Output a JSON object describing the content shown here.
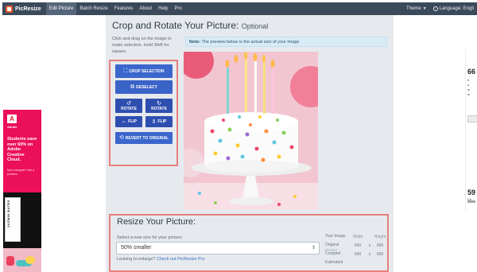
{
  "nav": {
    "brand": "PicResize",
    "items": [
      {
        "label": "Edit Picture",
        "active": true
      },
      {
        "label": "Batch Resize",
        "active": false
      },
      {
        "label": "Features",
        "active": false
      },
      {
        "label": "About",
        "active": false
      },
      {
        "label": "Help",
        "active": false
      },
      {
        "label": "Pro",
        "active": false
      }
    ],
    "theme_label": "Theme",
    "language_label": "Language: Engli"
  },
  "crop": {
    "title": "Crop and Rotate Your Picture:",
    "title_optional": "Optional",
    "hint": "Click and drag on the image to make selection. Hold Shift for square.",
    "note_bold": "Note:",
    "note_text": "The preview below is the actual size of your image",
    "buttons": {
      "crop": "CROP SELECTION",
      "deselect": "DESELECT",
      "rotate_left": "ROTATE",
      "rotate_right": "ROTATE",
      "flip_h": "FLIP",
      "flip_v": "FLIP",
      "revert": "REVERT TO ORIGINAL"
    }
  },
  "resize": {
    "title": "Resize Your Picture:",
    "select_label": "Select a new size for your picture:",
    "selected": "50% smaller",
    "enlarge_text": "Looking to enlarge?",
    "enlarge_link": "Check out PicResize Pro",
    "table": {
      "headers": [
        "Your Image",
        "Width",
        "Height"
      ],
      "rows": [
        {
          "label": "Original",
          "sub": "(Pixels)",
          "width": "600",
          "x": "x",
          "height": "600"
        },
        {
          "label": "Cropped",
          "sub": "",
          "width": "600",
          "x": "x",
          "height": "600"
        },
        {
          "label": "Estimated",
          "sub": "",
          "width": "",
          "x": "",
          "height": ""
        }
      ]
    }
  },
  "ad_left": {
    "brand": "Adobe",
    "copy": "Students save over 60% on Adobe Creative Cloud.",
    "small": "Not a designer? Not a problem.",
    "book": "JAZMIN BATES"
  },
  "ad_right": {
    "big_top": "66",
    "lines": [
      "e",
      "u",
      "w",
      "w"
    ],
    "big_bottom": "59",
    "small_bottom": "Ce"
  },
  "colors": {
    "nav_bg": "#3b4a5a",
    "button_blue": "#3a63c8",
    "highlight_border": "#e6807d",
    "panel_bg": "#e6eaee",
    "ad_pink": "#ec0f5a"
  },
  "icons": [
    "crop-icon",
    "deselect-icon",
    "rotate-left-icon",
    "rotate-right-icon",
    "flip-horizontal-icon",
    "flip-vertical-icon",
    "revert-icon",
    "globe-icon",
    "caret-down-icon",
    "adobe-logo-icon"
  ]
}
